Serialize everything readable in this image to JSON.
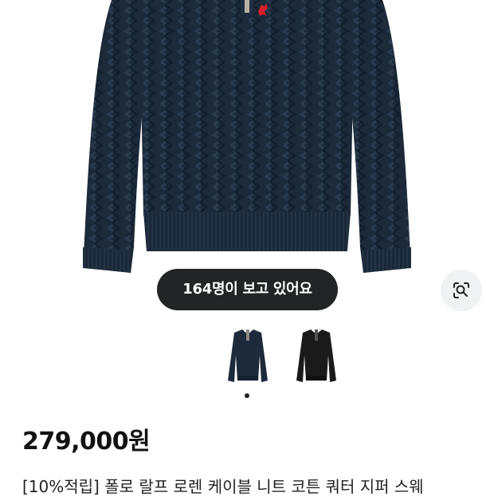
{
  "product": {
    "hero_icon": "sweater-navy-photo",
    "viewers_text": "164명이 보고 있어요",
    "lens_icon": "image-search-icon",
    "thumbnails": [
      {
        "color": "navy",
        "icon": "sweater-navy-thumb"
      },
      {
        "color": "black",
        "icon": "sweater-black-thumb"
      }
    ],
    "carousel_active_index": 1,
    "price": "279,000원",
    "title": "[10%적립] 폴로 랄프 로렌 케이블 니트 코튼 쿼터 지퍼 스웨"
  },
  "colors": {
    "badge_bg": "#222426",
    "sweater_navy": "#1c2a3a",
    "sweater_black": "#1a1a1a",
    "logo_red": "#d61f2a"
  }
}
